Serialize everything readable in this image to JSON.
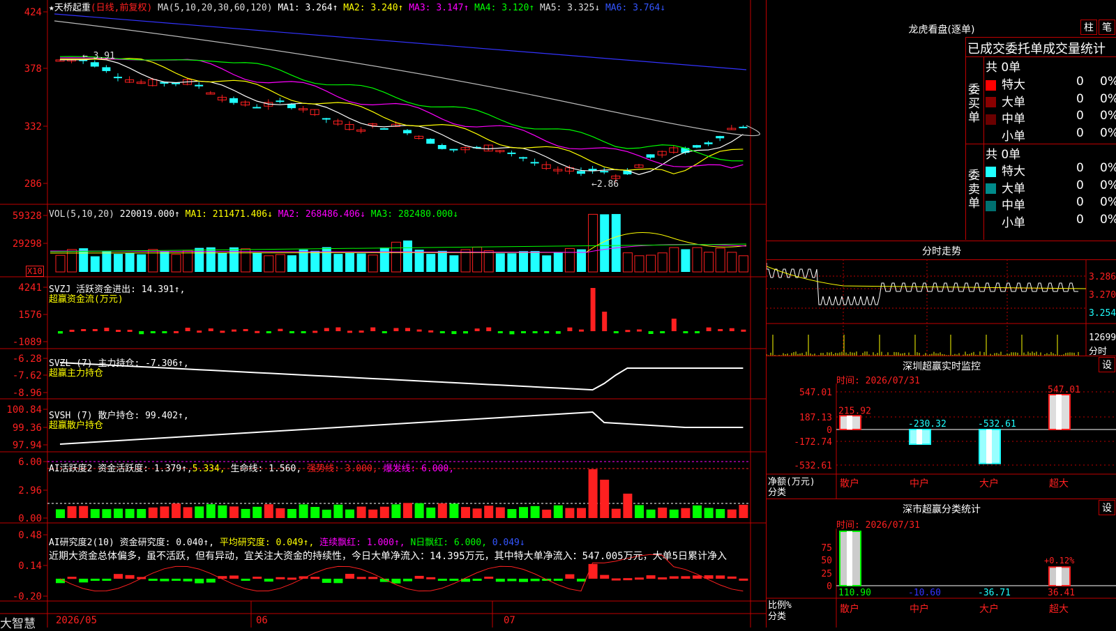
{
  "colors": {
    "up": "#ff2020",
    "down": "#20ffff",
    "grid": "#c00000",
    "yellow": "#ffff00",
    "magenta": "#ff00ff",
    "green": "#00ff00",
    "white": "#ffffff",
    "blue": "#3333ff"
  },
  "kline": {
    "icon": "★",
    "stock_name": "天桥起重",
    "period": "(日线,前复权)",
    "ma_params": "MA(5,10,20,30,60,120)",
    "ma_values": [
      "MA1: 3.264↑",
      "MA2: 3.240↑",
      "MA3: 3.147↑",
      "MA4: 3.120↑",
      "MA5: 3.325↓",
      "MA6: 3.764↓"
    ],
    "y_ticks": [
      "424",
      "378",
      "332",
      "286"
    ],
    "high_label": "3.91",
    "low_label": "2.86"
  },
  "vol": {
    "title": "VOL(5,10,20)",
    "values": [
      "220019.000↑",
      "MA1: 211471.406↓",
      "MA2: 268486.406↓",
      "MA3: 282480.000↓"
    ],
    "y_ticks": [
      "59328",
      "29298"
    ],
    "unit": "X10"
  },
  "svzj": {
    "title": "SVZJ  活跃资金进出: 14.391↑,",
    "subtitle": "超赢资金流(万元)",
    "y_ticks": [
      "4241",
      "1576",
      "-1089"
    ]
  },
  "svzl": {
    "title": "SVZL (7) 主力持仓: -7.306↑,",
    "subtitle": "超赢主力持仓",
    "y_ticks": [
      "-6.28",
      "-7.62",
      "-8.96"
    ]
  },
  "svsh": {
    "title": "SVSH (7) 散户持仓: 99.402↑,",
    "subtitle": "超赢散户持仓",
    "y_ticks": [
      "100.84",
      "99.36",
      "97.94"
    ]
  },
  "ai1": {
    "parts": [
      "AI活跃度2 资金活跃度: 1.379↑,",
      "5.334,",
      "生命线: 1.560,",
      "强势线: 3.000,",
      "爆发线: 6.000,"
    ],
    "y_ticks": [
      "6.00",
      "2.96",
      "0.00"
    ]
  },
  "ai2": {
    "parts": [
      "AI研究度2(10) 资金研究度: 0.040↑,",
      "平均研究度: 0.049↑,",
      "连续飘红: 1.000↑,",
      "N日飘红: 6.000,",
      "0.049↓"
    ],
    "y_ticks": [
      "0.48",
      "0.14",
      "-0.20"
    ],
    "comment": "近期大资金总体偏多，虽不活跃，但有异动，宜关注大资金的持续性，今日大单净流入：14.395万元，其中特大单净流入：547.005万元，大单5日累计净入"
  },
  "bottom": {
    "brand": "大智慧",
    "dates": [
      "2026/05",
      "06",
      "07"
    ]
  },
  "dragon": {
    "title": "龙虎看盘(逐单)",
    "btn1": "柱",
    "btn2": "笔",
    "header": "已成交委托单成交量统计",
    "buy_label": "委买单",
    "sell_label": "委卖单",
    "buy_total": "共 0单",
    "sell_total": "共 0单",
    "buy": [
      {
        "name": "特大",
        "n": "0",
        "p": "0%"
      },
      {
        "name": "大单",
        "n": "0",
        "p": "0%"
      },
      {
        "name": "中单",
        "n": "0",
        "p": "0%"
      },
      {
        "name": "小单",
        "n": "0",
        "p": "0%"
      }
    ],
    "sell": [
      {
        "name": "特大",
        "n": "0",
        "p": "0%"
      },
      {
        "name": "大单",
        "n": "0",
        "p": "0%"
      },
      {
        "name": "中单",
        "n": "0",
        "p": "0%"
      },
      {
        "name": "小单",
        "n": "0",
        "p": "0%"
      }
    ]
  },
  "intraday": {
    "title": "分时走势",
    "prices": [
      "3.286",
      "3.270",
      "3.254"
    ],
    "vol_label": "12699",
    "label": "分时"
  },
  "monitor": {
    "title": "深圳超赢实时监控",
    "btn": "设",
    "time": "时间: 2026/07/31",
    "y_ticks": [
      "547.01",
      "187.13",
      "0",
      "-172.74",
      "-532.61"
    ],
    "net_label": "净额(万元)",
    "class_label": "分类",
    "cats": [
      "散户",
      "中户",
      "大户",
      "超大"
    ],
    "values": [
      215.92,
      -230.32,
      -532.61,
      547.01
    ],
    "value_labels": [
      "215.92",
      "-230.32",
      "-532.61",
      "547.01"
    ]
  },
  "classify": {
    "title": "深市超赢分类统计",
    "btn": "设",
    "time": "时间: 2026/07/31",
    "y_ticks": [
      "75",
      "50",
      "25",
      "0"
    ],
    "ratio_label": "比例%",
    "class_label": "分类",
    "cats": [
      "散户",
      "中户",
      "大户",
      "超大"
    ],
    "values": [
      110.9,
      -10.6,
      -36.71,
      36.41
    ],
    "value_labels": [
      "110.90",
      "-10.60",
      "-36.71",
      "36.41"
    ],
    "extra_label": "+0.12%"
  }
}
